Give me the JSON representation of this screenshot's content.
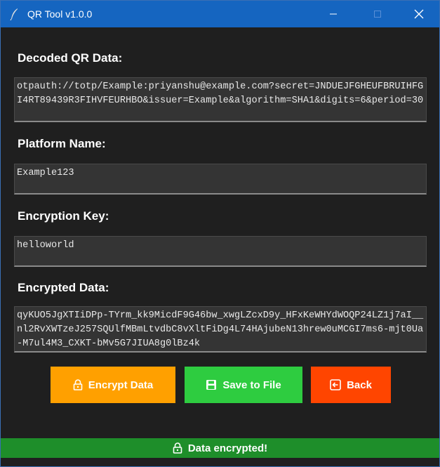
{
  "window": {
    "title": "QR Tool v1.0.0"
  },
  "fields": {
    "decoded": {
      "label": "Decoded QR Data:",
      "value": "otpauth://totp/Example:priyanshu@example.com?secret=JNDUEJFGHEUFBRUIHFGI4RT89439R3FIHVFEURHBO&issuer=Example&algorithm=SHA1&digits=6&period=30"
    },
    "platform": {
      "label": "Platform Name:",
      "value": "Example123"
    },
    "key": {
      "label": "Encryption Key:",
      "value": "helloworld"
    },
    "encrypted": {
      "label": "Encrypted Data:",
      "value": "qyKUO5JgXTIiDPp-TYrm_kk9MicdF9G46bw_xwgLZcxD9y_HFxKeWHYdWOQP24LZ1j7aI__nl2RvXWTzeJ257SQUlfMBmLtvdbC8vXltFiDg4L74HAjubeN13hrew0uMCGI7ms6-mjt0Ua-M7ul4M3_CXKT-bMv5G7JIUA8g0lBz4k"
    }
  },
  "buttons": {
    "encrypt": "Encrypt Data",
    "save": "Save to File",
    "back": "Back"
  },
  "status": {
    "text": "Data encrypted!"
  },
  "colors": {
    "titlebar": "#1565c0",
    "encrypt": "#ffa000",
    "save": "#2ecc40",
    "back": "#ff4500",
    "status": "#1e8e2a"
  },
  "icons": {
    "app": "feather-icon",
    "encrypt": "lock-icon",
    "save": "floppy-disk-icon",
    "back": "back-arrow-icon",
    "status": "lock-icon"
  }
}
